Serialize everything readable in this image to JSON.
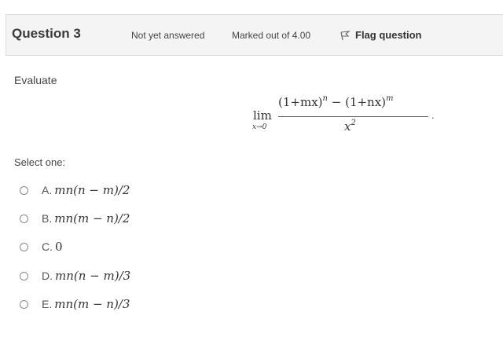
{
  "header": {
    "title": "Question 3",
    "state": "Not yet answered",
    "marks": "Marked out of 4.00",
    "flag_label": "Flag question"
  },
  "question": {
    "prompt": "Evaluate",
    "limit_word": "lim",
    "limit_subscript": "x→0",
    "numerator_part1": "(1+mx)",
    "numerator_exp1": "n",
    "minus": "−",
    "numerator_part2": "(1+nx)",
    "numerator_exp2": "m",
    "denominator_base": "x",
    "denominator_exp": "2",
    "end_period": "."
  },
  "answer": {
    "select_label": "Select one:",
    "options": [
      {
        "letter": "A.",
        "text": "mn(n − m)/2"
      },
      {
        "letter": "B.",
        "text": "mn(m − n)/2"
      },
      {
        "letter": "C.",
        "text": "0"
      },
      {
        "letter": "D.",
        "text": "mn(n − m)/3"
      },
      {
        "letter": "E.",
        "text": "mn(m − n)/3"
      }
    ]
  }
}
